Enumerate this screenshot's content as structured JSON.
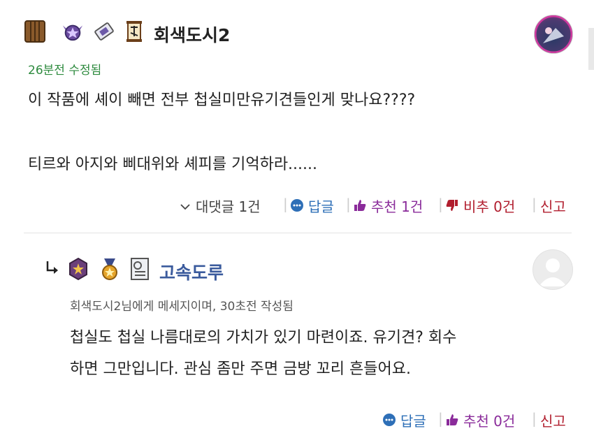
{
  "comment": {
    "author": "회색도시2",
    "meta": "26분전 수정됨",
    "lines": [
      "이 작품에 셰이 빼면 전부 첩실미만유기견들인게 맞나요????",
      "티르와 아지와 삐대위와 셰피를 기억하라......"
    ],
    "actions": {
      "replies": "대댓글 1건",
      "reply": "답글",
      "recommend": "추천 1건",
      "downvote": "비추 0건",
      "report": "신고"
    }
  },
  "reply": {
    "author": "고속도루",
    "meta": "회색도시2님에게 메세지이며, 30초전 작성됨",
    "lines": [
      "첩실도 첩실 나름대로의 가치가 있기 마련이죠. 유기견? 회수",
      "하면 그만입니다. 관심 좀만 주면 금방 꼬리 흔들어요."
    ],
    "actions": {
      "reply": "답글",
      "recommend": "추천 0건",
      "report": "신고"
    }
  },
  "colors": {
    "meta_green": "#2d8a3e",
    "reply_author_blue": "#3b5b9d",
    "action_blue": "#2e6fb7",
    "action_purple": "#8a2b9a",
    "action_red": "#b11e2e"
  },
  "icons": [
    "wooden-door-icon",
    "winged-star-badge-icon",
    "book-scroll-icon",
    "scroll-banner-icon",
    "reply-arrow-icon",
    "purple-star-medal-icon",
    "gold-medal-icon",
    "certificate-icon",
    "chat-bubble-icon",
    "thumbs-up-icon",
    "thumbs-down-icon",
    "chevron-down-icon"
  ]
}
